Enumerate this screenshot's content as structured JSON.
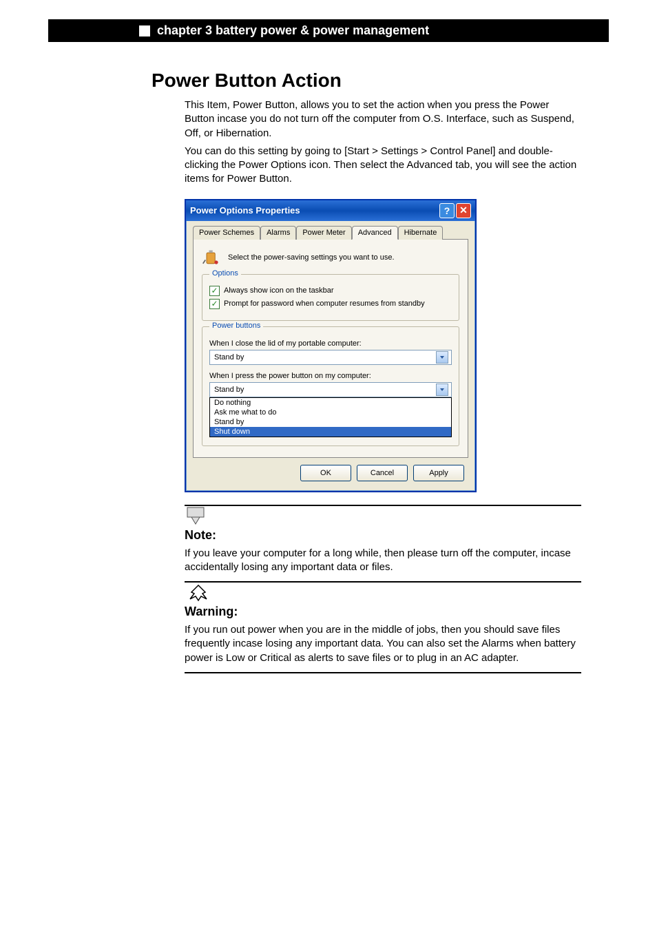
{
  "header": {
    "chapter_line": "chapter 3 battery power & power management"
  },
  "section": {
    "title": "Power Button Action",
    "para1": "This Item, Power Button, allows you to set the action when you press the Power Button incase you do not turn off the computer from O.S. Interface, such as Suspend, Off, or Hibernation.",
    "para2": "You can do this setting by going to [Start > Settings > Control Panel] and double-clicking the Power Options icon. Then select the Advanced tab, you will see the action items for Power Button."
  },
  "dialog": {
    "title": "Power Options Properties",
    "tabs": [
      "Power Schemes",
      "Alarms",
      "Power Meter",
      "Advanced",
      "Hibernate"
    ],
    "active_tab": "Advanced",
    "intro_text": "Select the power-saving settings you want to use.",
    "options_group": {
      "legend": "Options",
      "chk1": "Always show icon on the taskbar",
      "chk2": "Prompt for password when computer resumes from standby"
    },
    "power_buttons_group": {
      "legend": "Power buttons",
      "lid_label": "When I close the lid of my portable computer:",
      "lid_value": "Stand by",
      "power_label": "When I press the power button on my computer:",
      "power_value": "Stand by",
      "dropdown_options": [
        "Do nothing",
        "Ask me what to do",
        "Stand by",
        "Shut down"
      ],
      "dropdown_selected": "Shut down"
    },
    "buttons": {
      "ok": "OK",
      "cancel": "Cancel",
      "apply": "Apply"
    }
  },
  "notes": {
    "note_label": "Note:",
    "note_text": "If you leave your computer for a long while, then please turn off the computer, incase accidentally losing any important data or files.",
    "warn_label": "Warning:",
    "warn_text": "If you run out power when you are in the middle of jobs, then you should save files frequently incase losing any important data. You can also set the Alarms when battery power is Low or Critical as alerts to save files or to plug in an AC adapter."
  }
}
